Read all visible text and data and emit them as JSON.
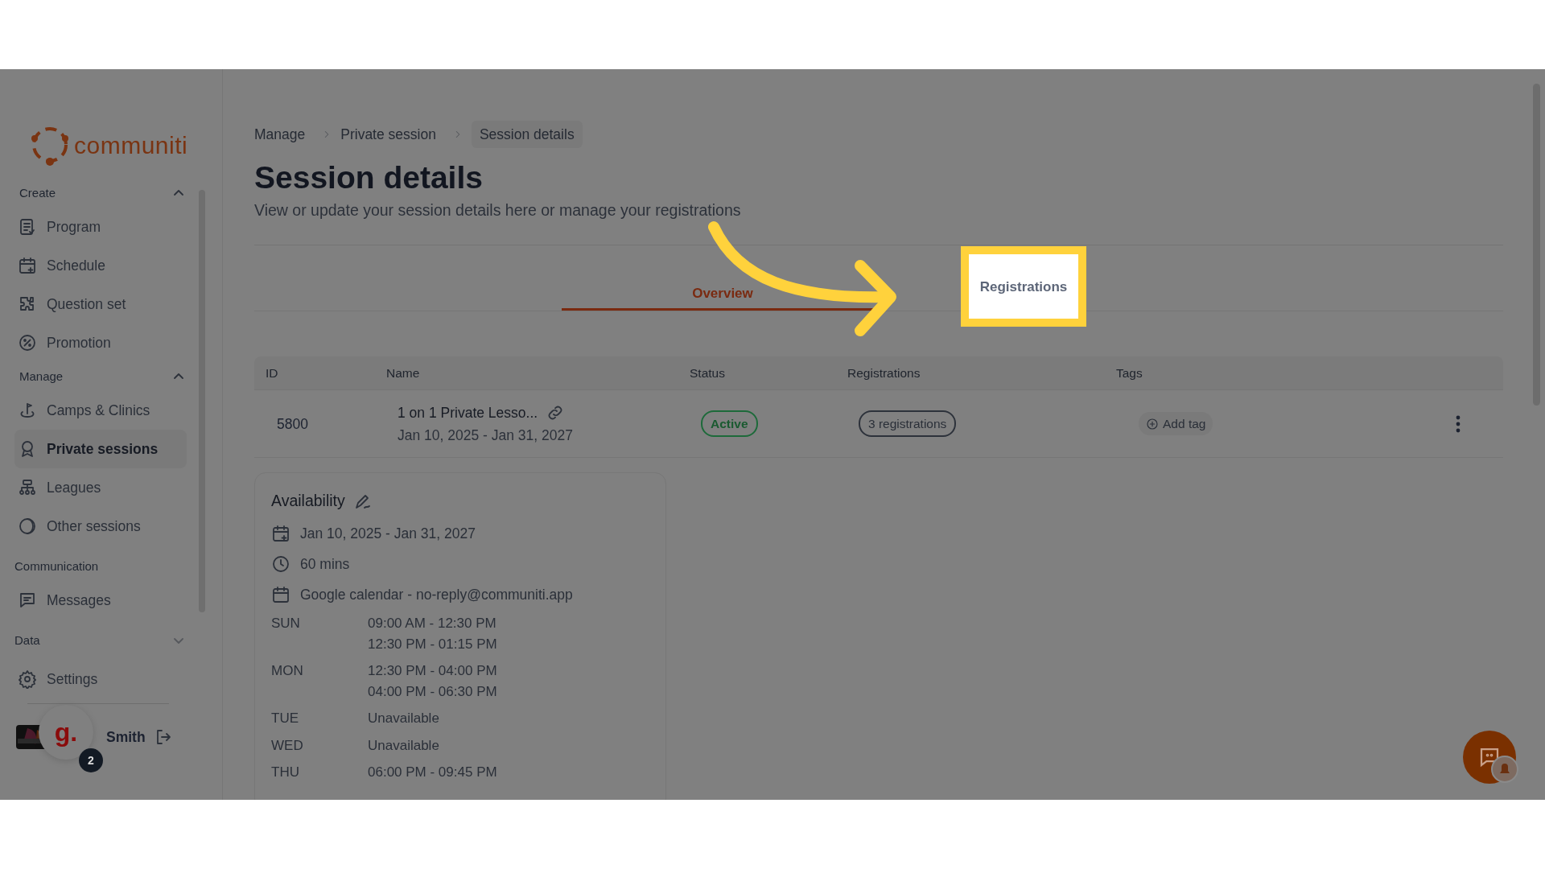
{
  "logo": {
    "text": "communiti"
  },
  "sidebar": {
    "sections": [
      {
        "title": "Create",
        "expanded": true,
        "items": [
          {
            "label": "Program",
            "selected": false
          },
          {
            "label": "Schedule",
            "selected": false
          },
          {
            "label": "Question set",
            "selected": false
          },
          {
            "label": "Promotion",
            "selected": false
          }
        ]
      },
      {
        "title": "Manage",
        "expanded": true,
        "items": [
          {
            "label": "Camps & Clinics",
            "selected": false
          },
          {
            "label": "Private sessions",
            "selected": true
          },
          {
            "label": "Leagues",
            "selected": false
          },
          {
            "label": "Other sessions",
            "selected": false
          }
        ]
      },
      {
        "title": "Communication",
        "items": [
          {
            "label": "Messages",
            "selected": false
          }
        ]
      },
      {
        "title": "Data",
        "expanded": false
      }
    ],
    "settings": {
      "label": "Settings"
    },
    "user": {
      "name": "Smith",
      "notifications": "2"
    },
    "widget": {
      "label": "g."
    }
  },
  "breadcrumb": [
    {
      "label": "Manage",
      "selected": false
    },
    {
      "label": "Private session",
      "selected": false
    },
    {
      "label": "Session details",
      "selected": true
    }
  ],
  "title": "Session details",
  "subtitle": "View or update your session details here or manage your registrations",
  "tabs": [
    {
      "label": "Overview",
      "selected": true,
      "highlighted": false
    },
    {
      "label": "Registrations",
      "selected": false,
      "highlighted": true
    }
  ],
  "table": {
    "columns": [
      "ID",
      "Name",
      "Status",
      "Registrations",
      "Tags"
    ],
    "rows": [
      {
        "id": "5800",
        "name": "1 on 1 Private Lesso...",
        "dates": "Jan 10, 2025 - Jan 31, 2027",
        "status": "Active",
        "registrations": "3 registrations",
        "tag_action": "Add tag"
      }
    ]
  },
  "availability": {
    "title": "Availability",
    "details": [
      {
        "kind": "dates",
        "text": "Jan 10, 2025 - Jan 31, 2027"
      },
      {
        "kind": "duration",
        "text": "60 mins"
      },
      {
        "kind": "calendar",
        "text": "Google calendar - no-reply@communiti.app"
      }
    ],
    "schedule": [
      {
        "day": "SUN",
        "slots": [
          "09:00 AM - 12:30 PM",
          "12:30 PM - 01:15 PM"
        ]
      },
      {
        "day": "MON",
        "slots": [
          "12:30 PM - 04:00 PM",
          "04:00 PM - 06:30 PM"
        ]
      },
      {
        "day": "TUE",
        "slots": [
          "Unavailable"
        ]
      },
      {
        "day": "WED",
        "slots": [
          "Unavailable"
        ]
      },
      {
        "day": "THU",
        "slots": [
          "06:00 PM - 09:45 PM"
        ]
      }
    ]
  }
}
